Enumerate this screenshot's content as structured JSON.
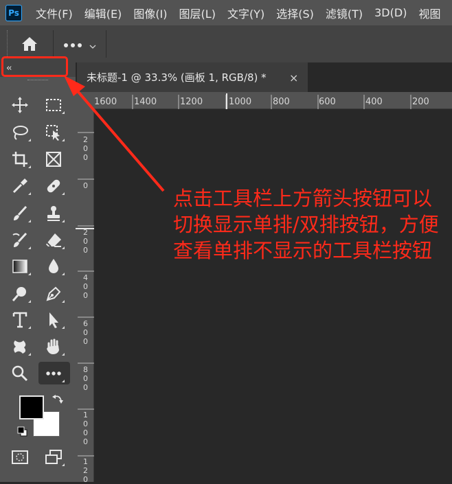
{
  "app": {
    "logo": "Ps"
  },
  "menu": [
    "文件(F)",
    "编辑(E)",
    "图像(I)",
    "图层(L)",
    "文字(Y)",
    "选择(S)",
    "滤镜(T)",
    "3D(D)",
    "视图"
  ],
  "options": {
    "home_icon": "home-icon",
    "more_icon": "more-horizontal-icon"
  },
  "toolbar": {
    "collapse_label": "‹‹",
    "tools": [
      {
        "name": "move-icon"
      },
      {
        "name": "marquee-icon"
      },
      {
        "name": "lasso-icon"
      },
      {
        "name": "object-select-icon"
      },
      {
        "name": "crop-icon"
      },
      {
        "name": "frame-icon"
      },
      {
        "name": "eyedropper-icon"
      },
      {
        "name": "healing-brush-icon"
      },
      {
        "name": "brush-icon"
      },
      {
        "name": "clone-stamp-icon"
      },
      {
        "name": "history-brush-icon"
      },
      {
        "name": "eraser-icon"
      },
      {
        "name": "gradient-icon"
      },
      {
        "name": "blur-icon"
      },
      {
        "name": "dodge-icon"
      },
      {
        "name": "pen-icon"
      },
      {
        "name": "type-icon"
      },
      {
        "name": "path-select-icon"
      },
      {
        "name": "shape-icon"
      },
      {
        "name": "hand-icon"
      },
      {
        "name": "zoom-icon"
      },
      {
        "name": "more-tools-icon"
      }
    ],
    "foreground_color": "#000000",
    "background_color": "#ffffff"
  },
  "document": {
    "tab_title": "未标题-1 @ 33.3% (画板 1, RGB/8) *",
    "close": "×"
  },
  "ruler_h": [
    "1600",
    "1400",
    "1200",
    "1000",
    "800",
    "600",
    "400",
    "200"
  ],
  "ruler_v": [
    "200",
    "0",
    "200",
    "400",
    "600",
    "800",
    "1000",
    "120"
  ],
  "annotation": {
    "text": "点击工具栏上方箭头按钮可以切换显示单排/双排按钮，方便查看单排不显示的工具栏按钮",
    "color": "#ff2a1a"
  }
}
